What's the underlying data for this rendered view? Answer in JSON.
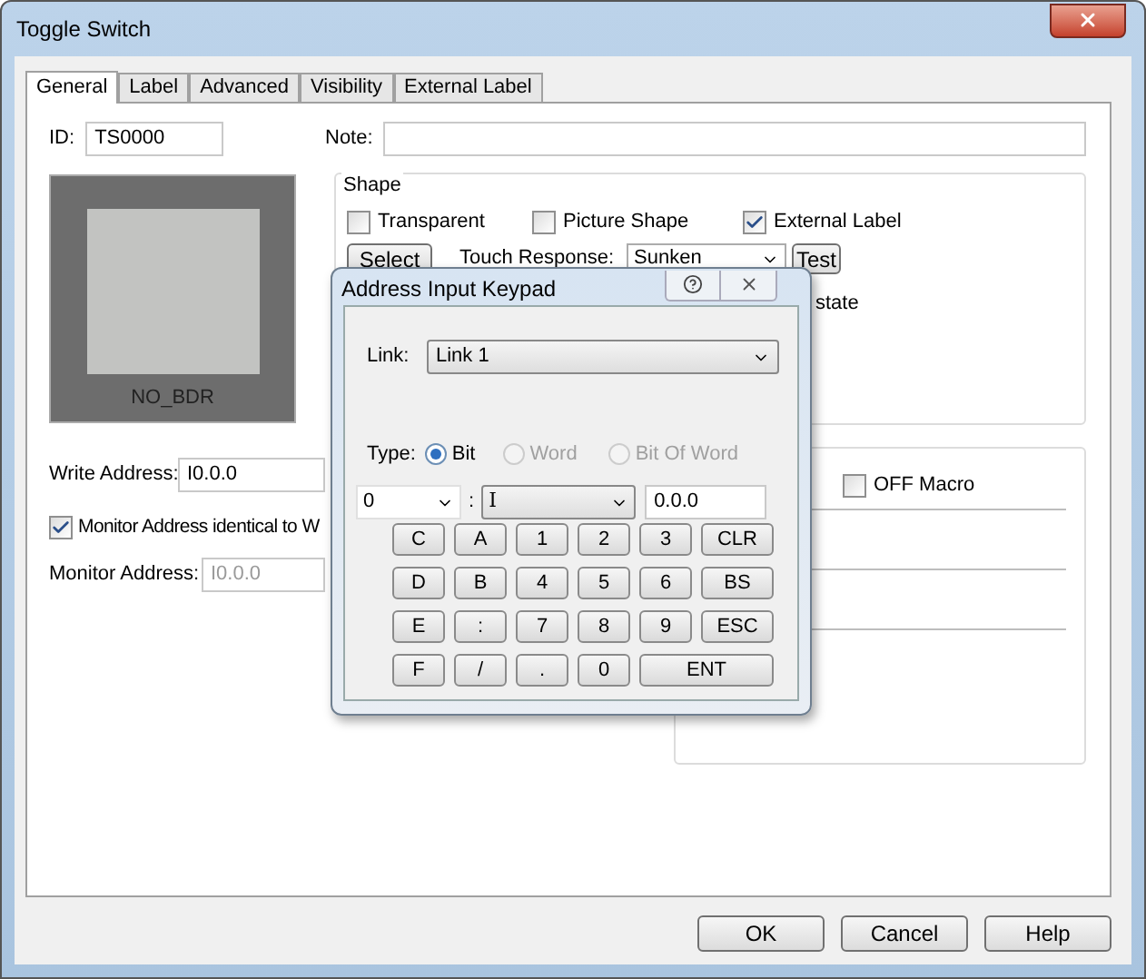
{
  "window": {
    "title": "Toggle Switch"
  },
  "tabs": [
    {
      "label": "General",
      "selected": true
    },
    {
      "label": "Label",
      "selected": false
    },
    {
      "label": "Advanced",
      "selected": false
    },
    {
      "label": "Visibility",
      "selected": false
    },
    {
      "label": "External Label",
      "selected": false
    }
  ],
  "general": {
    "id_label": "ID:",
    "id": "TS0000",
    "note_label": "Note:",
    "preview_caption": "NO_BDR",
    "write_address_label": "Write Address:",
    "write_address": "I0.0.0",
    "monitor_identical": {
      "label": "Monitor Address identical to W",
      "checked": true
    },
    "monitor_address_label": "Monitor Address:",
    "monitor_address": {
      "value": "I0.0.0",
      "disabled": true
    }
  },
  "shape": {
    "title": "Shape",
    "options": [
      {
        "label": "Transparent",
        "checked": false
      },
      {
        "label": "Picture Shape",
        "checked": false
      },
      {
        "label": "External Label",
        "checked": true
      }
    ],
    "select_button": "Select",
    "touch_response_label": "Touch Response:",
    "touch_response": "Sunken",
    "test_button": "Test",
    "state_text": "state"
  },
  "macro": {
    "off_macro": {
      "label": "OFF Macro",
      "checked": false
    }
  },
  "keypad": {
    "title": "Address Input Keypad",
    "link_label": "Link:",
    "link": "Link 1",
    "type_label": "Type:",
    "types": [
      {
        "label": "Bit",
        "selected": true,
        "disabled": false
      },
      {
        "label": "Word",
        "selected": false,
        "disabled": true
      },
      {
        "label": "Bit Of Word",
        "selected": false,
        "disabled": true
      }
    ],
    "station": "0",
    "separator": ":",
    "device": "I",
    "address": "0.0.0",
    "keys": [
      {
        "label": "C"
      },
      {
        "label": "A"
      },
      {
        "label": "1"
      },
      {
        "label": "2"
      },
      {
        "label": "3"
      },
      {
        "label": "CLR"
      },
      {
        "label": "D"
      },
      {
        "label": "B"
      },
      {
        "label": "4"
      },
      {
        "label": "5"
      },
      {
        "label": "6"
      },
      {
        "label": "BS"
      },
      {
        "label": "E"
      },
      {
        "label": ":"
      },
      {
        "label": "7"
      },
      {
        "label": "8"
      },
      {
        "label": "9"
      },
      {
        "label": "ESC"
      },
      {
        "label": "F"
      },
      {
        "label": "/"
      },
      {
        "label": "."
      },
      {
        "label": "0"
      },
      {
        "label": "ENT",
        "wide": true
      }
    ]
  },
  "buttons": [
    "OK",
    "Cancel",
    "Help"
  ]
}
